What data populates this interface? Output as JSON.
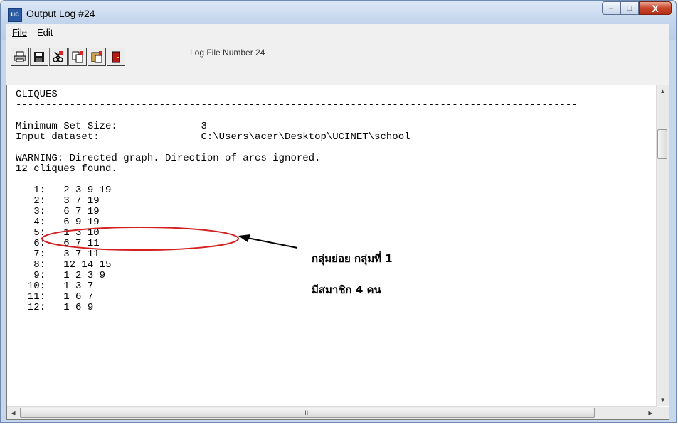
{
  "window": {
    "title": "Output Log #24",
    "app_icon": "uc",
    "min_glyph": "–",
    "max_glyph": "□",
    "close_glyph": "X"
  },
  "menu": {
    "file": "File",
    "edit": "Edit"
  },
  "toolbar": {
    "buttons": [
      "print-icon",
      "save-icon",
      "cut-icon",
      "copy-icon",
      "paste-icon",
      "exit-icon"
    ],
    "log_file_label": "Log File Number 24"
  },
  "log": {
    "text": "CLIQUES\n----------------------------------------------------------------------------------------------\n\nMinimum Set Size:              3\nInput dataset:                 C:\\Users\\acer\\Desktop\\UCINET\\school\n\nWARNING: Directed graph. Direction of arcs ignored.\n12 cliques found.\n\n   1:   2 3 9 19\n   2:   3 7 19\n   3:   6 7 19\n   4:   6 9 19\n   5:   1 3 10\n   6:   6 7 11\n   7:   3 7 11\n   8:   12 14 15\n   9:   1 2 3 9\n  10:   1 3 7\n  11:   1 6 7\n  12:   1 6 9"
  },
  "annotation": {
    "line1": "กลุ่มย่อย กลุ่มที่ 1",
    "line2": "มีสมาชิก 4 คน"
  },
  "scrollbar": {
    "hthumb_glyph": "III"
  },
  "colors": {
    "highlight_ellipse": "#d42020",
    "close_button": "#c7442a"
  }
}
